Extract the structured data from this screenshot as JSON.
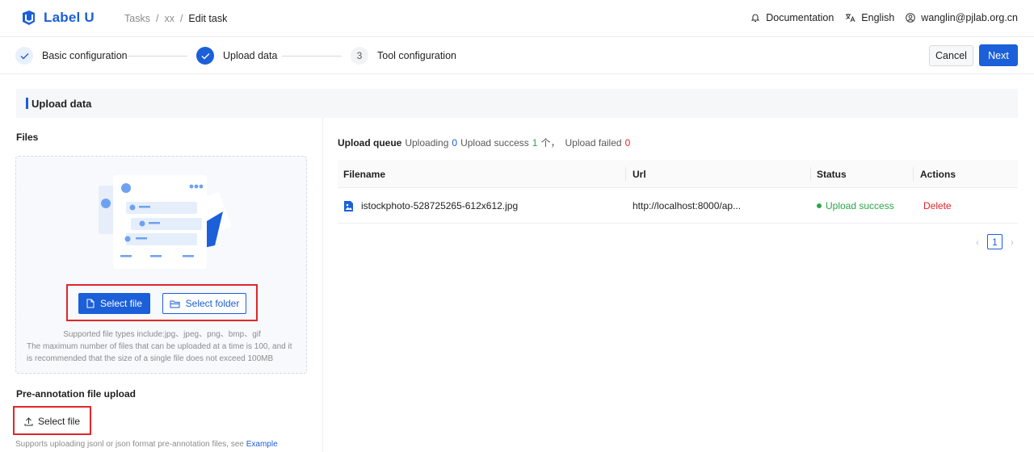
{
  "header": {
    "app_name": "Label U",
    "breadcrumb": [
      "Tasks",
      "/",
      "xx",
      "/",
      "Edit task"
    ],
    "documentation": "Documentation",
    "language": "English",
    "user": "wanglin@pjlab.org.cn"
  },
  "steps": [
    {
      "label": "Basic configuration",
      "state": "done"
    },
    {
      "label": "Upload data",
      "state": "current"
    },
    {
      "label": "Tool configuration",
      "number": "3",
      "state": "todo"
    }
  ],
  "actions": {
    "cancel": "Cancel",
    "next": "Next"
  },
  "section_title": "Upload data",
  "files": {
    "label": "Files",
    "select_file": "Select file",
    "select_folder": "Select folder",
    "supported_types": "Supported file types include:jpg、jpeg、png、bmp、gif",
    "limit_hint": "The maximum number of files that can be uploaded at a time is 100, and it is recommended that the size of a single file does not exceed 100MB"
  },
  "pre_annotation": {
    "label": "Pre-annotation file upload",
    "select_file": "Select file",
    "hint": "Supports uploading jsonl or json format pre-annotation files, see",
    "example_link": "Example"
  },
  "queue": {
    "title": "Upload queue",
    "uploading_label": "Uploading",
    "uploading_count": "0",
    "success_label": "Upload success",
    "success_count": "1",
    "success_suffix": "个，",
    "failed_label": "Upload failed",
    "failed_count": "0"
  },
  "table": {
    "columns": [
      "Filename",
      "Url",
      "Status",
      "Actions"
    ],
    "rows": [
      {
        "filename": "istockphoto-528725265-612x612.jpg",
        "url": "http://localhost:8000/ap...",
        "status": "Upload success",
        "action": "Delete"
      }
    ]
  },
  "pagination": {
    "current": "1",
    "prev": "‹",
    "next": "›"
  },
  "colors": {
    "primary": "#1b5fd9",
    "success": "#2aa74a",
    "danger": "#e0262a",
    "highlight_box": "#e0262a"
  }
}
